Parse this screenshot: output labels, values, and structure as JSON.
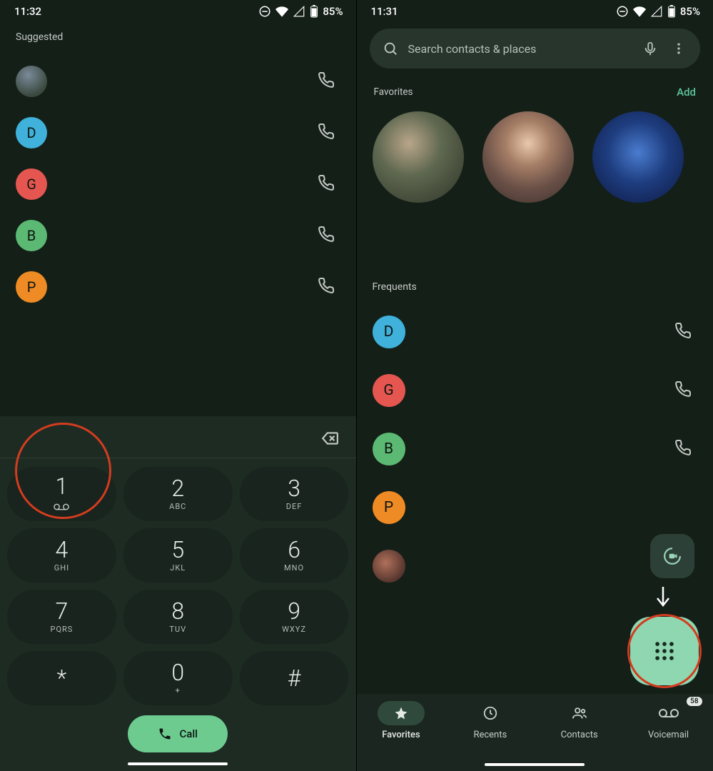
{
  "left": {
    "time": "11:32",
    "battery": "85%",
    "suggested_label": "Suggested",
    "suggested": [
      {
        "initial": "",
        "photo": true
      },
      {
        "initial": "D",
        "color": "#3FB1DB"
      },
      {
        "initial": "G",
        "color": "#E65650"
      },
      {
        "initial": "B",
        "color": "#5CB974"
      },
      {
        "initial": "P",
        "color": "#EE8B24"
      }
    ],
    "keypad": [
      {
        "digit": "1",
        "sub": "",
        "voicemail": true
      },
      {
        "digit": "2",
        "sub": "ABC"
      },
      {
        "digit": "3",
        "sub": "DEF"
      },
      {
        "digit": "4",
        "sub": "GHI"
      },
      {
        "digit": "5",
        "sub": "JKL"
      },
      {
        "digit": "6",
        "sub": "MNO"
      },
      {
        "digit": "7",
        "sub": "PQRS"
      },
      {
        "digit": "8",
        "sub": "TUV"
      },
      {
        "digit": "9",
        "sub": "WXYZ"
      },
      {
        "digit": "*",
        "sub": ""
      },
      {
        "digit": "0",
        "sub": "+"
      },
      {
        "digit": "#",
        "sub": ""
      }
    ],
    "call_label": "Call"
  },
  "right": {
    "time": "11:31",
    "battery": "85%",
    "search_placeholder": "Search contacts & places",
    "favorites_label": "Favorites",
    "add_label": "Add",
    "frequents_label": "Frequents",
    "frequents": [
      {
        "initial": "D",
        "color": "#3FB1DB",
        "phone": true
      },
      {
        "initial": "G",
        "color": "#E65650",
        "phone": true
      },
      {
        "initial": "B",
        "color": "#5CB974",
        "phone": true
      },
      {
        "initial": "P",
        "color": "#EE8B24",
        "phone": false
      },
      {
        "initial": "",
        "photo": true,
        "phone": false
      }
    ],
    "nav": {
      "favorites": "Favorites",
      "recents": "Recents",
      "contacts": "Contacts",
      "voicemail": "Voicemail",
      "vm_count": "58"
    }
  }
}
